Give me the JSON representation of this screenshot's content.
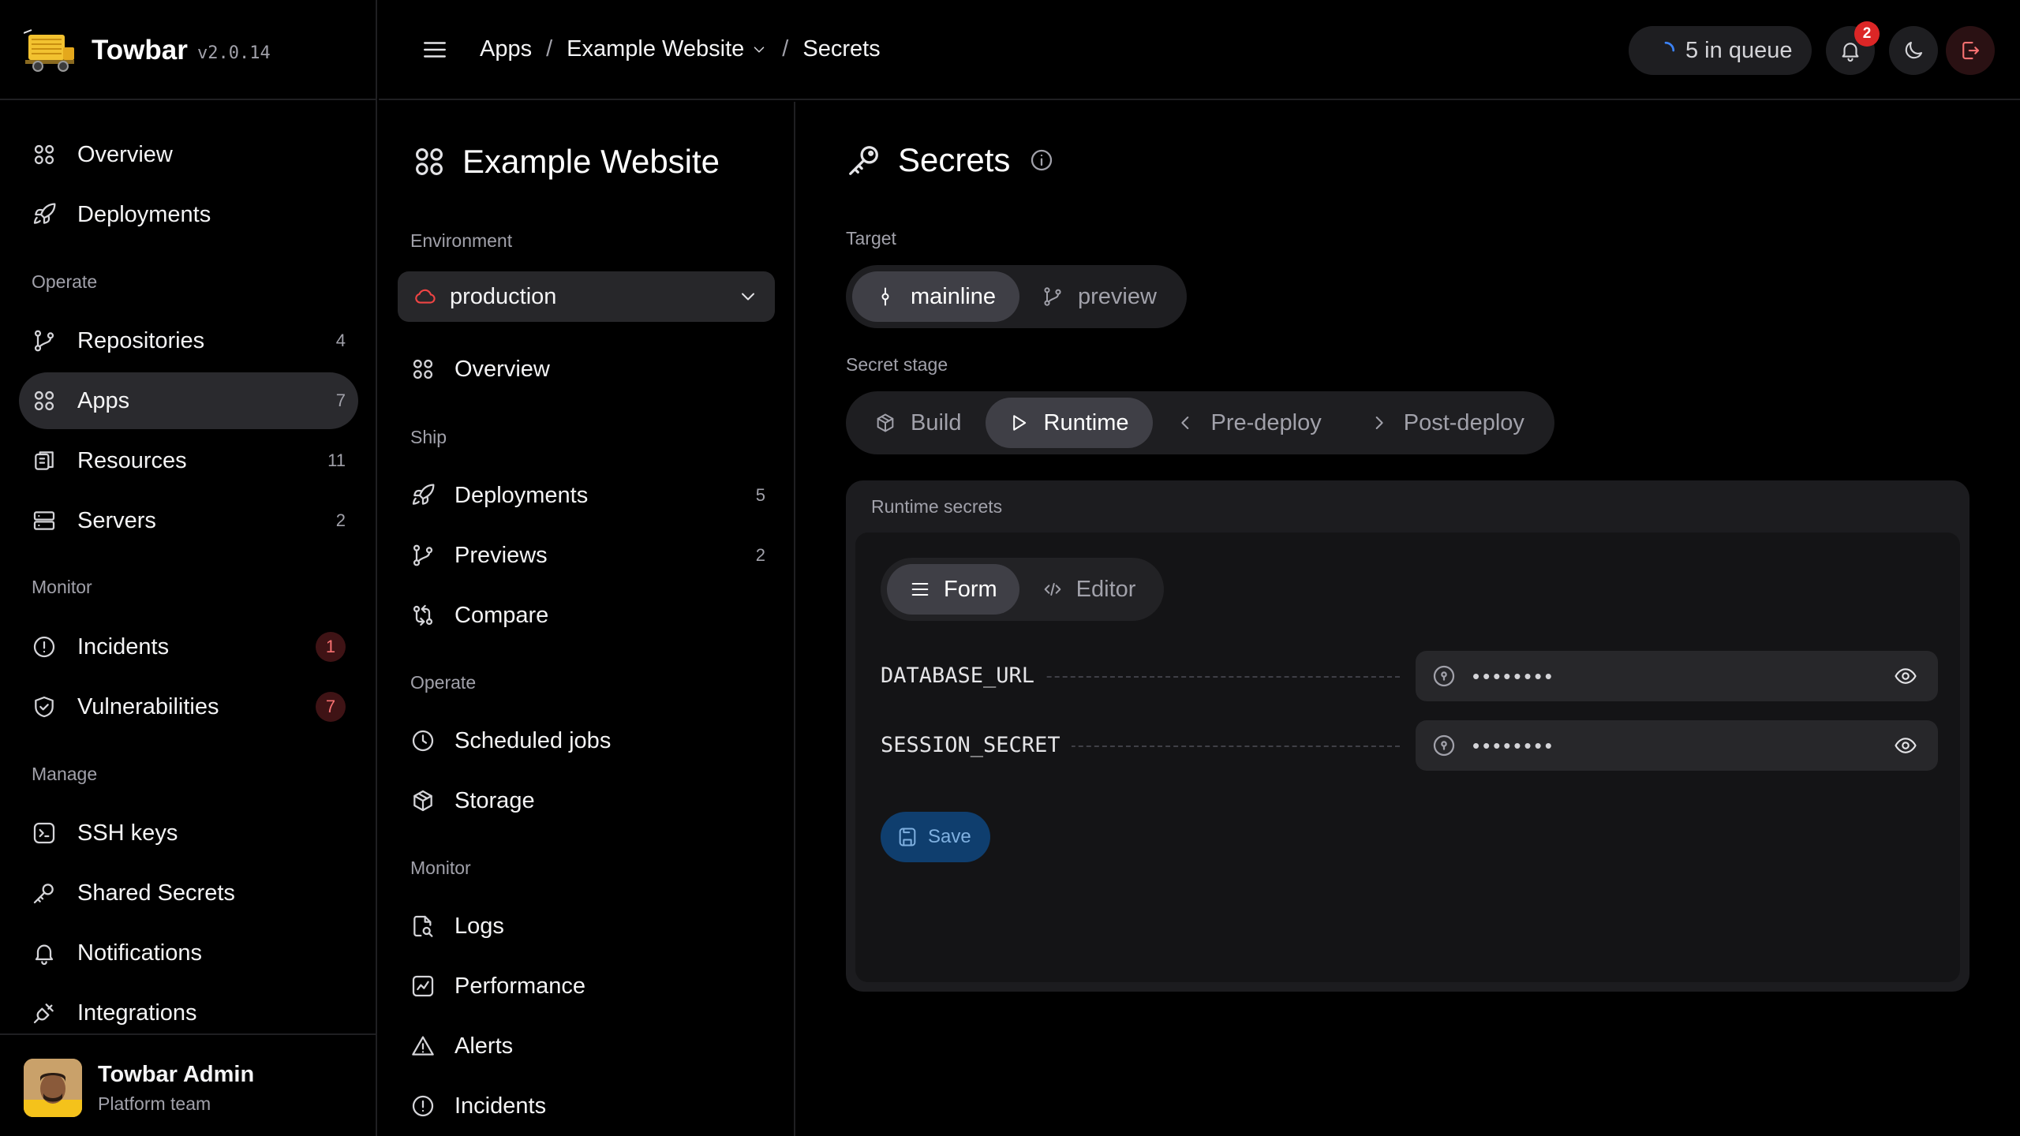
{
  "brand": {
    "name": "Towbar",
    "version": "v2.0.14"
  },
  "sidebar": {
    "top": [
      {
        "label": "Overview",
        "icon": "grid-icon"
      },
      {
        "label": "Deployments",
        "icon": "rocket-icon"
      }
    ],
    "sections": [
      {
        "label": "Operate"
      },
      {
        "label": "Monitor"
      },
      {
        "label": "Manage"
      }
    ],
    "operate": [
      {
        "label": "Repositories",
        "count": "4"
      },
      {
        "label": "Apps",
        "count": "7",
        "active": true
      },
      {
        "label": "Resources",
        "count": "11"
      },
      {
        "label": "Servers",
        "count": "2"
      }
    ],
    "monitor": [
      {
        "label": "Incidents",
        "badge": "1"
      },
      {
        "label": "Vulnerabilities",
        "badge": "7"
      }
    ],
    "manage": [
      {
        "label": "SSH keys"
      },
      {
        "label": "Shared Secrets"
      },
      {
        "label": "Notifications"
      },
      {
        "label": "Integrations"
      }
    ],
    "user": {
      "name": "Towbar Admin",
      "team": "Platform team"
    }
  },
  "topbar": {
    "breadcrumb": [
      "Apps",
      "/",
      "Example Website",
      "/",
      "Secrets"
    ],
    "queue": "5 in queue",
    "notifications_count": "2"
  },
  "app_panel": {
    "title": "Example Website",
    "environment_label": "Environment",
    "environment_value": "production",
    "overview": "Overview",
    "ship_label": "Ship",
    "ship": [
      {
        "label": "Deployments",
        "count": "5"
      },
      {
        "label": "Previews",
        "count": "2"
      },
      {
        "label": "Compare"
      }
    ],
    "operate_label": "Operate",
    "operate": [
      {
        "label": "Scheduled jobs"
      },
      {
        "label": "Storage"
      }
    ],
    "monitor_label": "Monitor",
    "monitor": [
      {
        "label": "Logs"
      },
      {
        "label": "Performance"
      },
      {
        "label": "Alerts"
      },
      {
        "label": "Incidents"
      }
    ]
  },
  "main": {
    "title": "Secrets",
    "target_label": "Target",
    "targets": [
      "mainline",
      "preview"
    ],
    "stage_label": "Secret stage",
    "stages": [
      "Build",
      "Runtime",
      "Pre-deploy",
      "Post-deploy"
    ],
    "card_title": "Runtime secrets",
    "tabs": [
      "Form",
      "Editor"
    ],
    "secrets": [
      {
        "key": "DATABASE_URL",
        "value": "••••••••"
      },
      {
        "key": "SESSION_SECRET",
        "value": "••••••••"
      }
    ],
    "save_label": "Save"
  },
  "colors": {
    "accent_blue": "#0f3e6e",
    "badge_red": "#dc2626",
    "background": "#000000"
  }
}
